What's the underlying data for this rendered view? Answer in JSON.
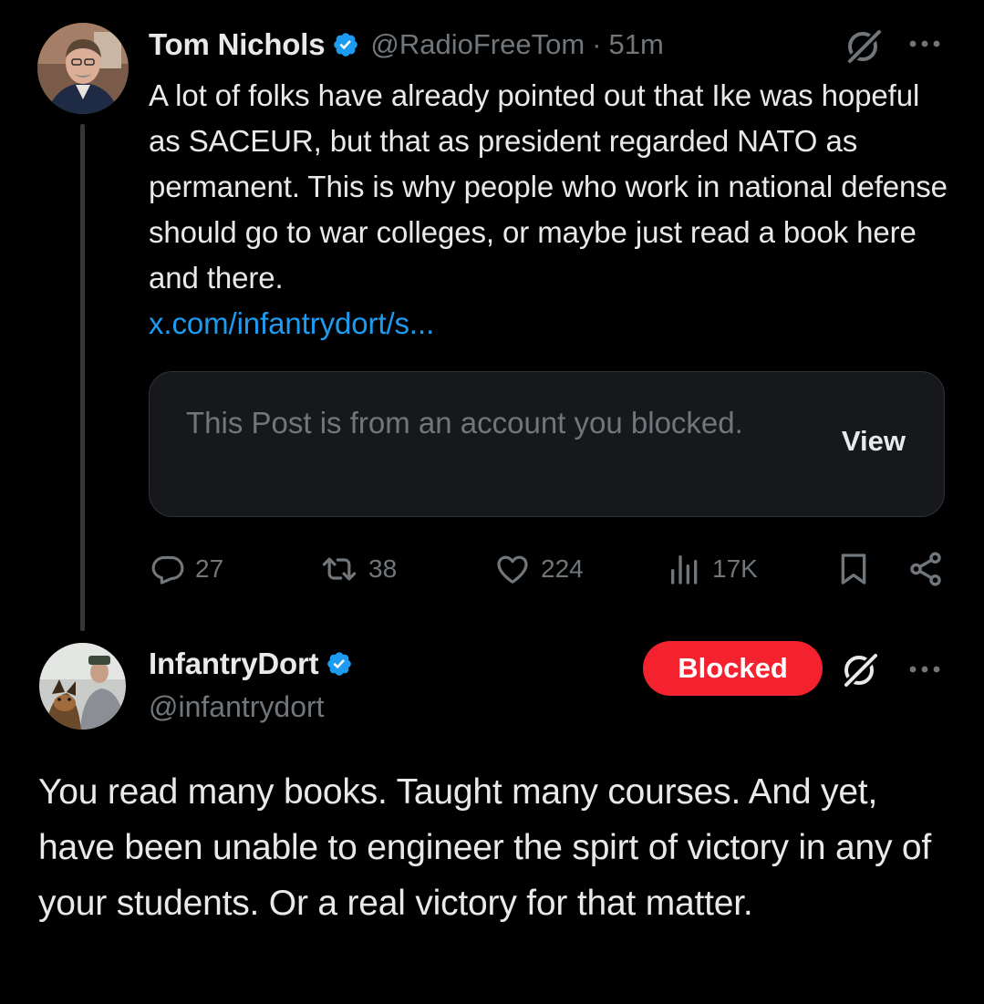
{
  "colors": {
    "background": "#000000",
    "text_primary": "#e7e9ea",
    "text_secondary": "#71767b",
    "link": "#1d9bf0",
    "verified_badge": "#1d9bf0",
    "blocked_pill": "#f4212e",
    "card_background": "#16181c"
  },
  "post": {
    "author": {
      "display_name": "Tom Nichols",
      "handle": "@RadioFreeTom",
      "separator": "·",
      "time": "51m",
      "verified": true
    },
    "text": "A lot of folks have already pointed out that Ike was hopeful as SACEUR, but that as president regarded NATO as permanent. This is why people who work in national defense should go to war colleges, or maybe just read a book here and there.",
    "link_text": "x.com/infantrydort/s...",
    "quote": {
      "text": "This Post is from an account you blocked.",
      "view_label": "View"
    },
    "actions": {
      "replies": "27",
      "reposts": "38",
      "likes": "224",
      "views": "17K"
    },
    "icons": [
      "grok-icon",
      "more-icon",
      "reply-icon",
      "repost-icon",
      "like-icon",
      "views-icon",
      "bookmark-icon",
      "share-icon"
    ]
  },
  "reply": {
    "author": {
      "display_name": "InfantryDort",
      "handle": "@infantrydort",
      "verified": true
    },
    "blocked_label": "Blocked",
    "text": "You read many books. Taught many courses. And yet, have been unable to engineer the spirt of victory in any of your students. Or a real victory for that matter."
  }
}
